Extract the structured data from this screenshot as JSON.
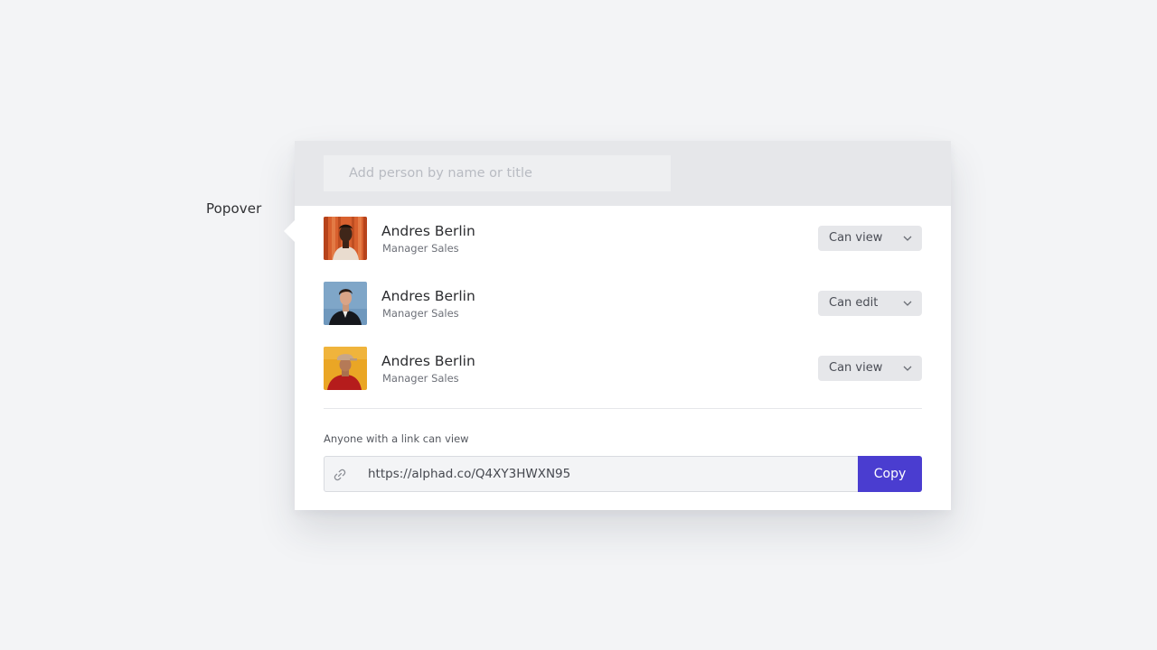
{
  "annotation": {
    "label": "Popover"
  },
  "search": {
    "placeholder": "Add person by name or title"
  },
  "people": [
    {
      "name": "Andres Berlin",
      "title": "Manager Sales",
      "permission": "Can view"
    },
    {
      "name": "Andres Berlin",
      "title": "Manager Sales",
      "permission": "Can edit"
    },
    {
      "name": "Andres Berlin",
      "title": "Manager Sales",
      "permission": "Can view"
    }
  ],
  "share_link": {
    "caption": "Anyone with a link can view",
    "url": "https://alphad.co/Q4XY3HWXN95",
    "copy_label": "Copy",
    "icon": "link-icon"
  },
  "colors": {
    "accent": "#4a3dd0",
    "page_background": "#f3f4f6",
    "header_background": "#e6e7ea"
  },
  "icons": {
    "dropdown": "chevron-down-icon",
    "link": "link-icon"
  }
}
